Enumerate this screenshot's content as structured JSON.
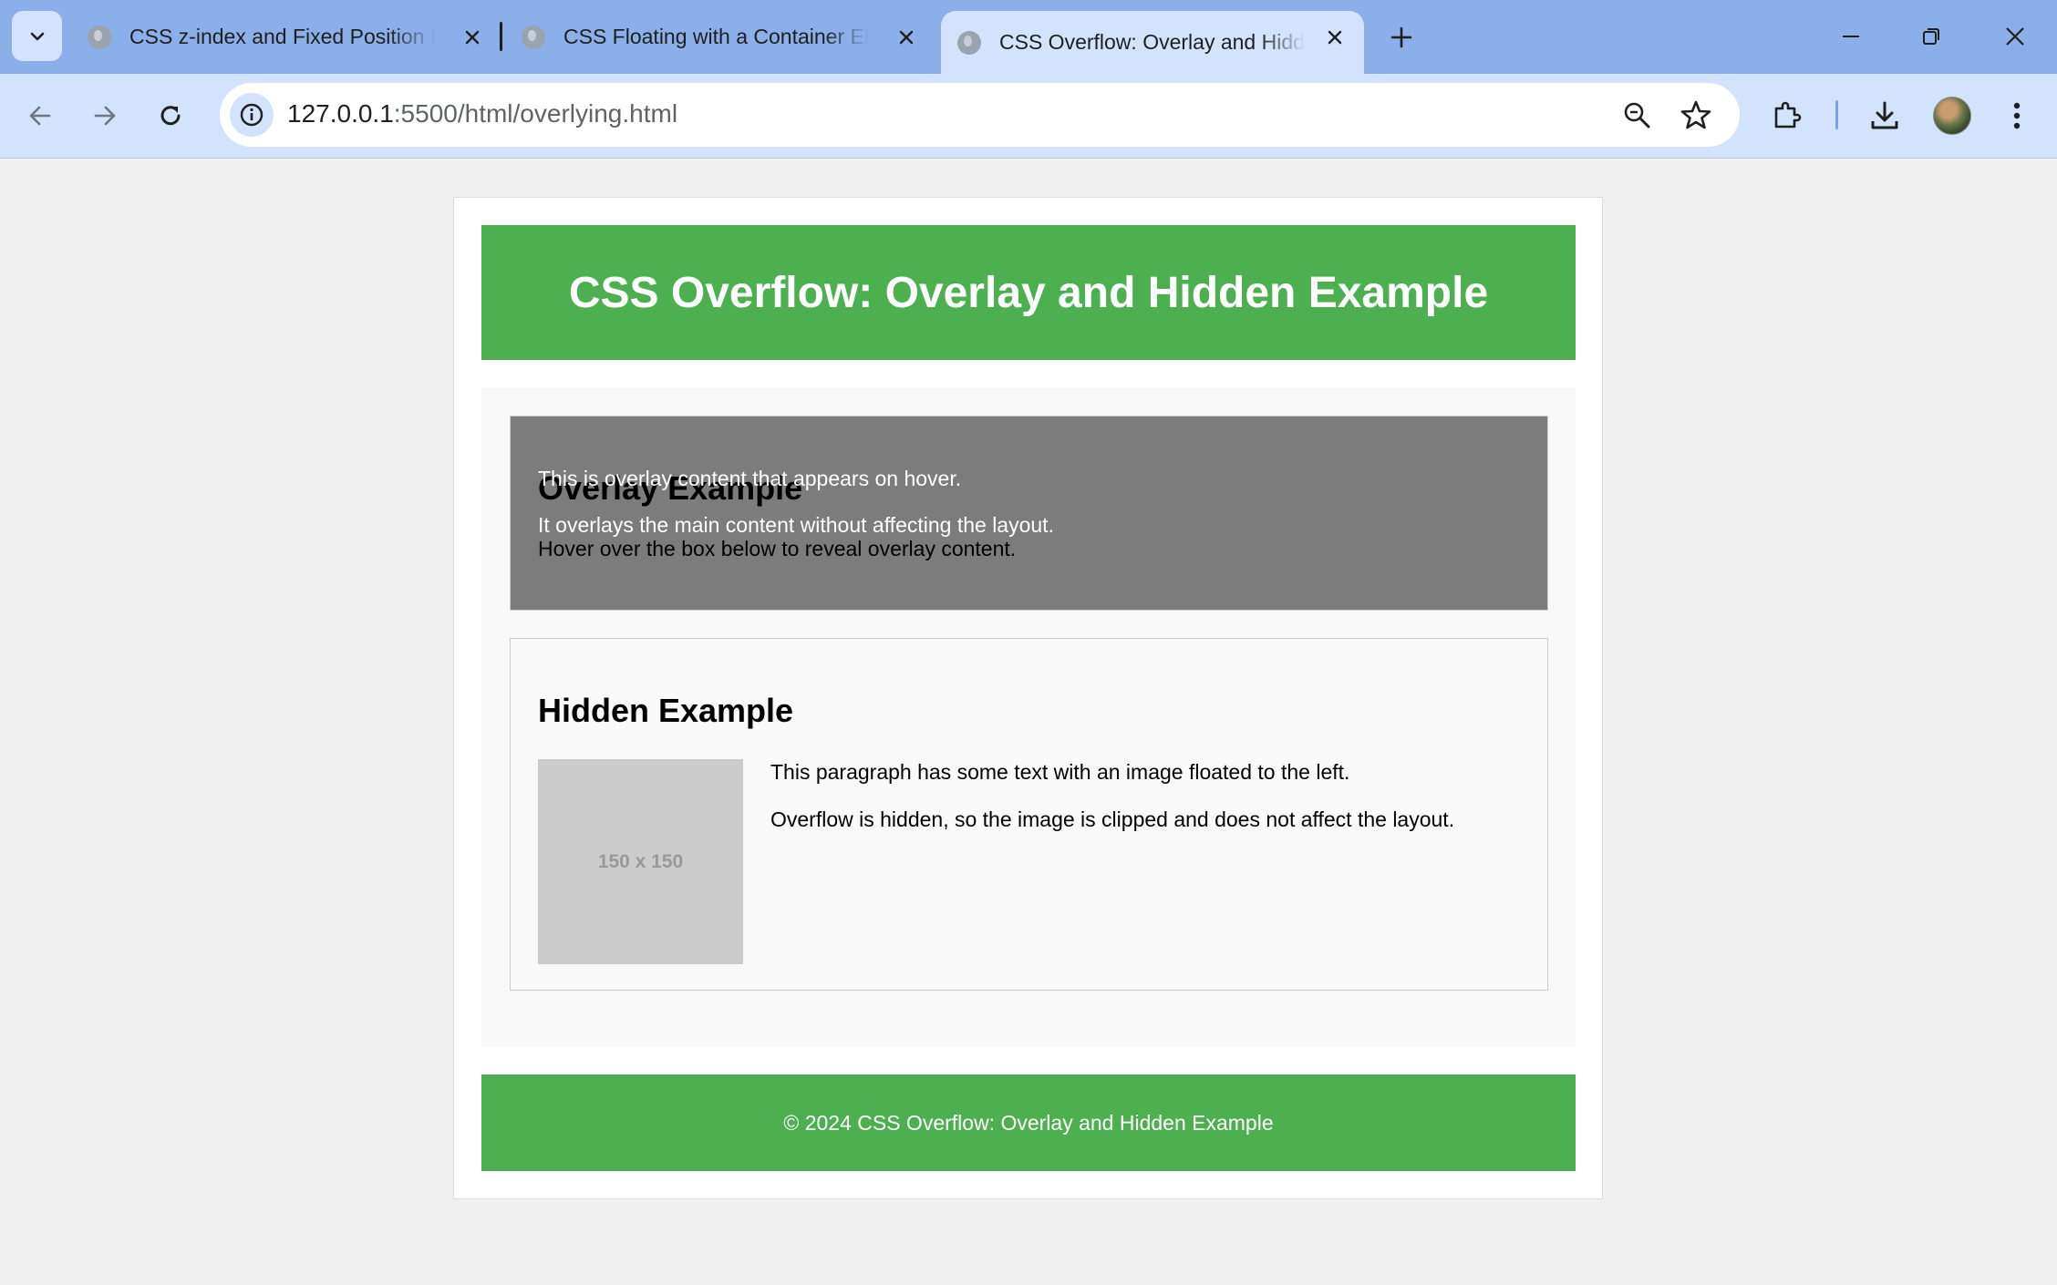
{
  "browser": {
    "tabs": [
      {
        "title": "CSS z-index and Fixed Position Example",
        "active": false
      },
      {
        "title": "CSS Floating with a Container Element",
        "active": false
      },
      {
        "title": "CSS Overflow: Overlay and Hidden Example",
        "active": true
      }
    ],
    "url_host": "127.0.0.1",
    "url_rest": ":5500/html/overlying.html"
  },
  "page": {
    "title": "CSS Overflow: Overlay and Hidden Example",
    "overlay_section": {
      "heading": "Overlay Example",
      "text": "Hover over the box below to reveal overlay content.",
      "overlay_line1": "This is overlay content that appears on hover.",
      "overlay_line2": "It overlays the main content without affecting the layout."
    },
    "hidden_section": {
      "heading": "Hidden Example",
      "image_label": "150 x 150",
      "paragraph1": "This paragraph has some text with an image floated to the left.",
      "paragraph2": "Overflow is hidden, so the image is clipped and does not affect the layout."
    },
    "footer": "© 2024 CSS Overflow: Overlay and Hidden Example"
  },
  "colors": {
    "header_bg": "#4caf50",
    "tabstrip_bg": "#8aafe9",
    "toolbar_bg": "#d3e3fd"
  },
  "icons": [
    "tab-list-icon",
    "globe-icon",
    "close-icon",
    "new-tab-icon",
    "minimize-icon",
    "restore-icon",
    "back-icon",
    "forward-icon",
    "reload-icon",
    "site-info-icon",
    "zoom-icon",
    "bookmark-star-icon",
    "extensions-icon",
    "download-icon",
    "avatar",
    "more-menu-icon"
  ]
}
